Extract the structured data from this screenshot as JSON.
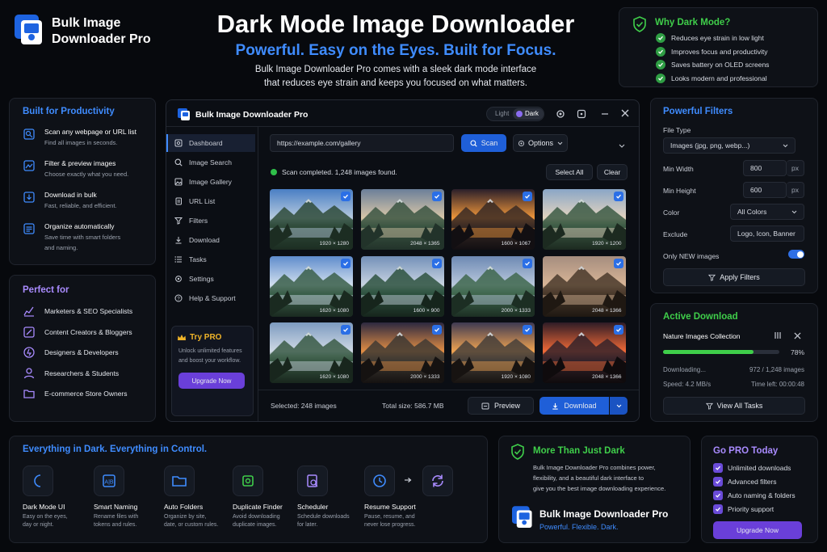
{
  "brand": {
    "line1": "Bulk Image",
    "line2": "Downloader Pro"
  },
  "hero": {
    "title": "Dark Mode Image Downloader",
    "subtitle": "Powerful. Easy on the Eyes. Built for Focus.",
    "desc1": "Bulk Image Downloader Pro comes with a sleek dark mode interface",
    "desc2": "that reduces eye strain and keeps you focused on what matters."
  },
  "why": {
    "title": "Why Dark Mode?",
    "items": [
      "Reduces eye strain in low light",
      "Improves focus and productivity",
      "Saves battery on OLED screens",
      "Looks modern and professional"
    ]
  },
  "productivity": {
    "title": "Built for Productivity",
    "items": [
      {
        "title": "Scan any webpage or URL list",
        "desc": "Find all images in seconds."
      },
      {
        "title": "Filter & preview images",
        "desc": "Choose exactly what you need."
      },
      {
        "title": "Download in bulk",
        "desc": "Fast, reliable, and efficient."
      },
      {
        "title": "Organize automatically",
        "desc": "Save time with smart folders",
        "desc2": "and naming."
      }
    ]
  },
  "perfect": {
    "title": "Perfect for",
    "items": [
      "Marketers & SEO Specialists",
      "Content Creators & Bloggers",
      "Designers & Developers",
      "Researchers & Students",
      "E-commerce Store Owners"
    ]
  },
  "app": {
    "title": "Bulk Image Downloader Pro",
    "theme_light": "Light",
    "theme_dark": "Dark",
    "nav": [
      "Dashboard",
      "Image Search",
      "Image Gallery",
      "URL List",
      "Filters",
      "Download",
      "Tasks",
      "Settings",
      "Help & Support"
    ],
    "url_value": "https://example.com/gallery",
    "scan_label": "Scan",
    "options_label": "Options",
    "status": "Scan completed. 1,248 images found.",
    "select_all": "Select All",
    "clear": "Clear",
    "thumbs": [
      "1920 × 1280",
      "2048 × 1365",
      "1600 × 1067",
      "1920 × 1200",
      "1620 × 1080",
      "1600 × 900",
      "2000 × 1333",
      "2048 × 1366",
      "1620 × 1080",
      "2000 × 1333",
      "1920 × 1080",
      "2048 × 1366"
    ],
    "try_pro": "Try PRO",
    "try_desc1": "Unlock unlimited features",
    "try_desc2": "and boost your workflow.",
    "upgrade": "Upgrade Now",
    "selected": "Selected: 248 images",
    "total": "Total size: 586.7 MB",
    "preview": "Preview",
    "download": "Download"
  },
  "filters": {
    "title": "Powerful Filters",
    "file_type_label": "File Type",
    "file_type_value": "Images (jpg, png, webp...)",
    "min_width_label": "Min Width",
    "min_width_value": "800",
    "min_height_label": "Min Height",
    "min_height_value": "600",
    "unit": "px",
    "color_label": "Color",
    "color_value": "All Colors",
    "exclude_label": "Exclude",
    "exclude_value": "Logo, Icon, Banner",
    "only_new_label": "Only NEW images",
    "only_new_on": true,
    "apply": "Apply Filters"
  },
  "active": {
    "title": "Active Download",
    "name": "Nature Images Collection",
    "percent": "78%",
    "progress": 0.78,
    "status": "Downloading...",
    "count": "972 / 1,248 images",
    "speed": "Speed: 4.2 MB/s",
    "time": "Time left: 00:00:48",
    "view_all": "View All Tasks"
  },
  "everything": {
    "title": "Everything in Dark. Everything in Control.",
    "features": [
      {
        "title": "Dark Mode UI",
        "d1": "Easy on the eyes,",
        "d2": "day or night."
      },
      {
        "title": "Smart Naming",
        "d1": "Rename files with",
        "d2": "tokens and rules."
      },
      {
        "title": "Auto Folders",
        "d1": "Organize by site,",
        "d2": "date, or custom rules."
      },
      {
        "title": "Duplicate Finder",
        "d1": "Avoid downloading",
        "d2": "duplicate images."
      },
      {
        "title": "Scheduler",
        "d1": "Schedule downloads",
        "d2": "for later."
      },
      {
        "title": "Resume Support",
        "d1": "Pause, resume, and",
        "d2": "never lose progress."
      }
    ]
  },
  "more": {
    "title": "More Than Just Dark",
    "d1": "Bulk Image Downloader Pro combines power,",
    "d2": "flexibility, and a beautiful dark interface to",
    "d3": "give you the best image downloading experience.",
    "brand": "Bulk Image Downloader Pro",
    "tagline": "Powerful. Flexible. Dark."
  },
  "gopro": {
    "title": "Go PRO Today",
    "items": [
      "Unlimited downloads",
      "Advanced filters",
      "Auto naming & folders",
      "Priority support"
    ],
    "button": "Upgrade Now"
  },
  "colors": {
    "accent": "#2f6fe4",
    "green": "#3fce4a",
    "purple": "#7a55e6",
    "bg": "#07090d"
  }
}
